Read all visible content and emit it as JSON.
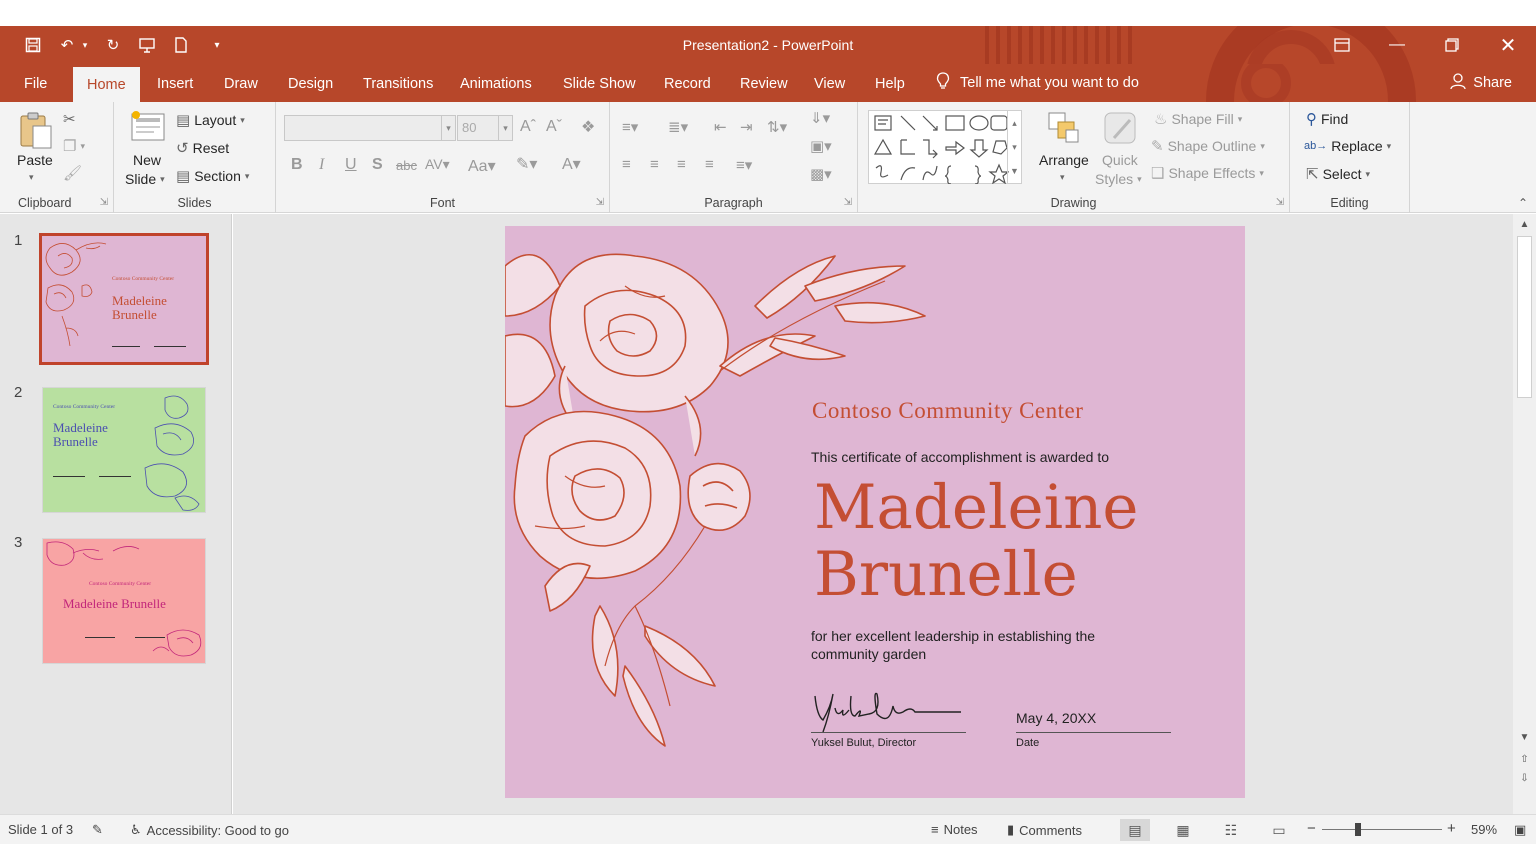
{
  "app": {
    "title": "Presentation2 - PowerPoint",
    "accent": "#b7472a"
  },
  "quick_access": [
    "save-icon",
    "undo-icon",
    "redo-icon",
    "present-icon",
    "new-file-icon",
    "customize-icon"
  ],
  "window_controls": [
    "ribbon-display-icon",
    "minimize-icon",
    "restore-icon",
    "close-icon"
  ],
  "tabs": [
    {
      "label": "File"
    },
    {
      "label": "Home"
    },
    {
      "label": "Insert"
    },
    {
      "label": "Draw"
    },
    {
      "label": "Design"
    },
    {
      "label": "Transitions"
    },
    {
      "label": "Animations"
    },
    {
      "label": "Slide Show"
    },
    {
      "label": "Record"
    },
    {
      "label": "Review"
    },
    {
      "label": "View"
    },
    {
      "label": "Help"
    }
  ],
  "active_tab": "Home",
  "tell_me": "Tell me what you want to do",
  "share_label": "Share",
  "ribbon": {
    "clipboard": {
      "label": "Clipboard",
      "paste": "Paste"
    },
    "slides": {
      "label": "Slides",
      "new_slide_1": "New",
      "new_slide_2": "Slide",
      "layout": "Layout",
      "reset": "Reset",
      "section": "Section"
    },
    "font": {
      "label": "Font",
      "font_name": "",
      "font_size": "80"
    },
    "paragraph": {
      "label": "Paragraph"
    },
    "drawing": {
      "label": "Drawing",
      "arrange": "Arrange",
      "quick_styles_1": "Quick",
      "quick_styles_2": "Styles",
      "shape_fill": "Shape Fill",
      "shape_outline": "Shape Outline",
      "shape_effects": "Shape Effects"
    },
    "editing": {
      "label": "Editing",
      "find": "Find",
      "replace": "Replace",
      "select": "Select"
    }
  },
  "thumbnails": [
    {
      "number": "1",
      "bg": "#dfb6d3",
      "ink": "#c44e33",
      "center": "Contoso Community Center",
      "name": "Madeleine Brunelle"
    },
    {
      "number": "2",
      "bg": "#b8e0a0",
      "ink": "#4b4fb0",
      "center": "Contoso Community Center",
      "name": "Madeleine Brunelle"
    },
    {
      "number": "3",
      "bg": "#f8a4a4",
      "ink": "#c2267a",
      "center": "Contoso Community Center",
      "name": "Madeleine Brunelle"
    }
  ],
  "slide": {
    "center_name": "Contoso Community Center",
    "award_line": "This certificate of accomplishment is awarded to",
    "recipient_first": "Madeleine",
    "recipient_last": "Brunelle",
    "reason": "for her excellent leadership in establishing the community garden",
    "signer": "Yuksel Bulut, Director",
    "date": "May 4, 20XX",
    "date_label": "Date",
    "bg_color": "#dfb6d3",
    "ink_color": "#c44e33"
  },
  "status": {
    "slide_counter": "Slide 1 of 3",
    "accessibility": "Accessibility: Good to go",
    "notes": "Notes",
    "comments": "Comments",
    "zoom": "59%"
  }
}
